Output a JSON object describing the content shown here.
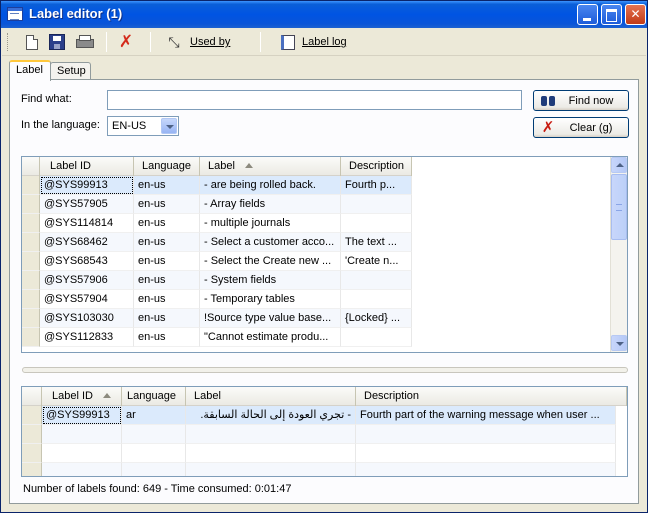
{
  "window": {
    "title": "Label editor (1)"
  },
  "toolbar": {
    "new_icon": "new-document-icon",
    "save_icon": "save-icon",
    "print_icon": "print-icon",
    "delete_icon": "delete-icon",
    "used_by_label": "Used by",
    "label_log_label": "Label log"
  },
  "tabs": [
    {
      "label": "Label"
    },
    {
      "label": "Setup"
    }
  ],
  "search": {
    "find_what_label": "Find what:",
    "find_value": "",
    "language_label": "In the language:",
    "language_value": "EN-US",
    "find_now_label": "Find now",
    "clear_label": "Clear (g)"
  },
  "upper_grid": {
    "columns": [
      "Label ID",
      "Language",
      "Label",
      "Description"
    ],
    "rows": [
      {
        "id": "@SYS99913",
        "lang": "en-us",
        "label": "- are being rolled back.",
        "desc": "Fourth  p..."
      },
      {
        "id": "@SYS57905",
        "lang": "en-us",
        "label": "- Array fields",
        "desc": ""
      },
      {
        "id": "@SYS114814",
        "lang": "en-us",
        "label": "- multiple journals",
        "desc": ""
      },
      {
        "id": "@SYS68462",
        "lang": "en-us",
        "label": "- Select a customer acco...",
        "desc": "The text ..."
      },
      {
        "id": "@SYS68543",
        "lang": "en-us",
        "label": "- Select the Create new ...",
        "desc": "'Create n..."
      },
      {
        "id": "@SYS57906",
        "lang": "en-us",
        "label": "- System fields",
        "desc": ""
      },
      {
        "id": "@SYS57904",
        "lang": "en-us",
        "label": "- Temporary tables",
        "desc": ""
      },
      {
        "id": "@SYS103030",
        "lang": "en-us",
        "label": "!Source type value base...",
        "desc": "{Locked} ..."
      },
      {
        "id": "@SYS112833",
        "lang": "en-us",
        "label": "\"Cannot estimate produ...",
        "desc": ""
      }
    ]
  },
  "lower_grid": {
    "columns": [
      "Label ID",
      "Language",
      "Label",
      "Description"
    ],
    "rows": [
      {
        "id": "@SYS99913",
        "lang": "ar",
        "label": "- تجري العودة إلى الحالة السابقة.",
        "desc": "Fourth  part of the warning message when user ..."
      }
    ]
  },
  "status": {
    "text": "Number of labels found: 649 - Time consumed:  0:01:47"
  }
}
